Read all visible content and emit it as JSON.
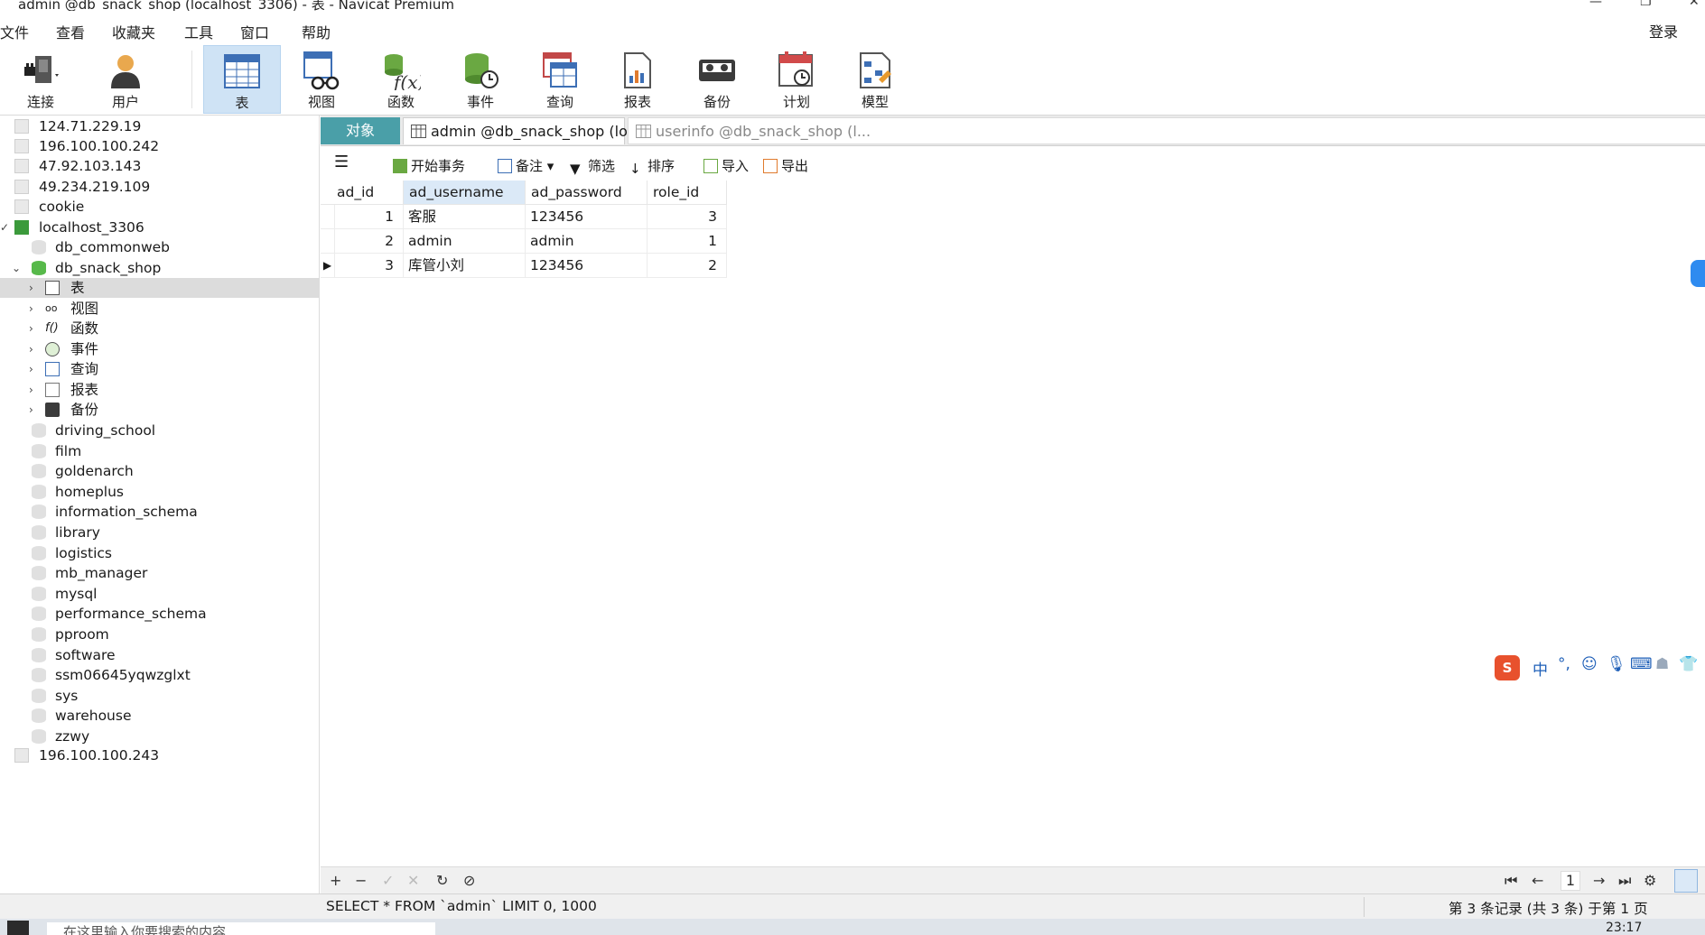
{
  "window": {
    "title": "admin @db_snack_shop (localhost_3306) - 表 - Navicat Premium"
  },
  "menu": [
    "文件",
    "查看",
    "收藏夹",
    "工具",
    "窗口",
    "帮助"
  ],
  "login_label": "登录",
  "toolbar": [
    {
      "label": "连接",
      "icon": "plug-icon"
    },
    {
      "label": "用户",
      "icon": "user-icon"
    },
    {
      "label": "表",
      "icon": "table-icon",
      "active": true
    },
    {
      "label": "视图",
      "icon": "view-icon"
    },
    {
      "label": "函数",
      "icon": "function-icon"
    },
    {
      "label": "事件",
      "icon": "event-icon"
    },
    {
      "label": "查询",
      "icon": "query-icon"
    },
    {
      "label": "报表",
      "icon": "report-icon"
    },
    {
      "label": "备份",
      "icon": "backup-icon"
    },
    {
      "label": "计划",
      "icon": "schedule-icon"
    },
    {
      "label": "模型",
      "icon": "model-icon"
    }
  ],
  "tree": {
    "connections_top": [
      "124.71.229.19",
      "196.100.100.242",
      "47.92.103.143",
      "49.234.219.109",
      "cookie"
    ],
    "localhost": "localhost_3306",
    "db_commonweb": "db_commonweb",
    "db_snack_shop": "db_snack_shop",
    "object_nodes": [
      "表",
      "视图",
      "函数",
      "事件",
      "查询",
      "报表",
      "备份"
    ],
    "databases": [
      "driving_school",
      "film",
      "goldenarch",
      "homeplus",
      "information_schema",
      "library",
      "logistics",
      "mb_manager",
      "mysql",
      "performance_schema",
      "pproom",
      "software",
      "ssm06645yqwzglxt",
      "sys",
      "warehouse",
      "zzwy"
    ],
    "connections_bottom": [
      "196.100.100.243"
    ]
  },
  "tabs": {
    "objects": "对象",
    "tab1": "admin @db_snack_shop (lo...",
    "tab2": "userinfo @db_snack_shop (l..."
  },
  "grid_toolbar": {
    "begin_tx": "开始事务",
    "note": "备注",
    "filter": "筛选",
    "sort": "排序",
    "import": "导入",
    "export": "导出"
  },
  "table": {
    "columns": [
      "ad_id",
      "ad_username",
      "ad_password",
      "role_id"
    ],
    "rows": [
      [
        "1",
        "客服",
        "123456",
        "3"
      ],
      [
        "2",
        "admin",
        "admin",
        "1"
      ],
      [
        "3",
        "库管小刘",
        "123456",
        "2"
      ]
    ]
  },
  "pager": {
    "page": "1"
  },
  "status": {
    "sql": "SELECT * FROM `admin` LIMIT 0, 1000",
    "records": "第 3 条记录 (共 3 条) 于第 1 页"
  },
  "taskbar": {
    "search_placeholder": "在这里输入你要搜索的内容",
    "clock": "23:17"
  },
  "ime": {
    "mode": "中"
  },
  "colors": {
    "objects_tab": "#4a9fa8",
    "active_toolbar": "#cfe3f5",
    "header_highlight": "#dbe9f7"
  }
}
